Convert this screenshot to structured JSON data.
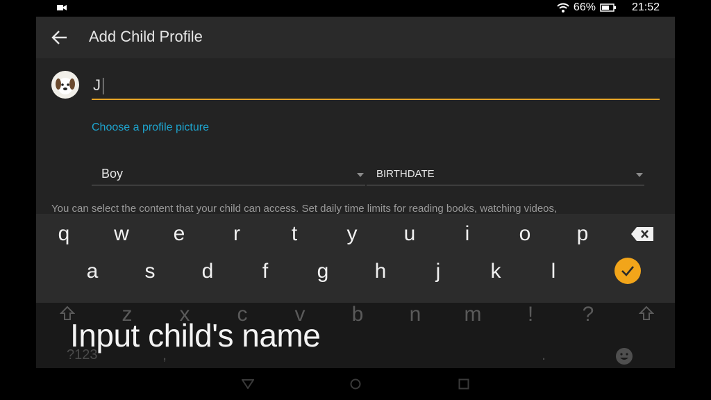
{
  "status_bar": {
    "battery": "66%",
    "time": "21:52"
  },
  "header": {
    "title": "Add Child Profile"
  },
  "form": {
    "name_value": "J",
    "choose_picture_link": "Choose a profile picture",
    "gender_value": "Boy",
    "birthdate_value": "BIRTHDATE",
    "info_text": "You can select the content that your child can access. Set daily time limits for reading books, watching videos,"
  },
  "keyboard": {
    "row1": [
      "q",
      "w",
      "e",
      "r",
      "t",
      "y",
      "u",
      "i",
      "o",
      "p"
    ],
    "row2": [
      "a",
      "s",
      "d",
      "f",
      "g",
      "h",
      "j",
      "k",
      "l"
    ],
    "row3": [
      "z",
      "x",
      "c",
      "v",
      "b",
      "n",
      "m",
      "!",
      "?"
    ],
    "bottom_left": "?123",
    "comma": ",",
    "period": "."
  },
  "caption": "Input child's name",
  "colors": {
    "accent": "#e7a527",
    "link": "#1ea5cf",
    "enter": "#f2a51a"
  }
}
